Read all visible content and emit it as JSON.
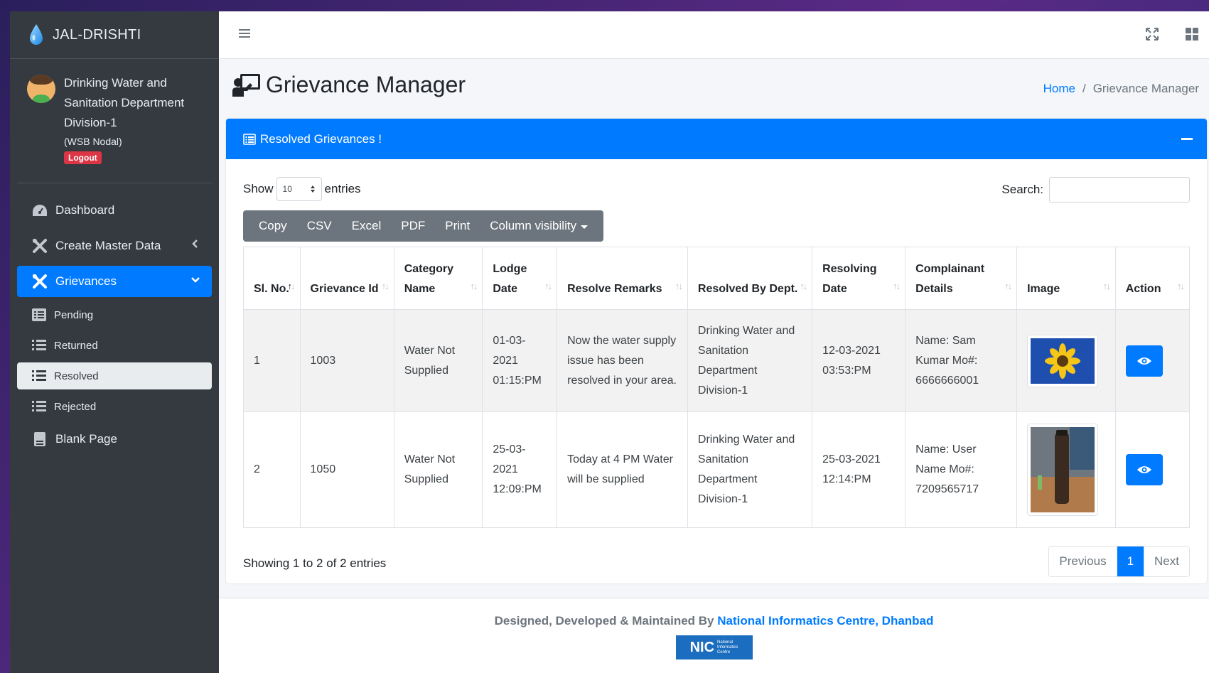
{
  "brand": {
    "name": "JAL-DRISHTI"
  },
  "user": {
    "name": "Drinking Water and Sanitation Department Division-1",
    "role": "(WSB Nodal)",
    "logout_label": "Logout"
  },
  "nav": {
    "dashboard": "Dashboard",
    "create_master": "Create Master Data",
    "grievances": "Grievances",
    "pending": "Pending",
    "returned": "Returned",
    "resolved": "Resolved",
    "rejected": "Rejected",
    "blank_page": "Blank Page"
  },
  "page": {
    "title": "Grievance Manager",
    "breadcrumb_home": "Home",
    "breadcrumb_sep": "/",
    "breadcrumb_current": "Grievance Manager"
  },
  "card": {
    "title": "Resolved Grievances !"
  },
  "controls": {
    "show": "Show",
    "entries_value": "10",
    "entries": "entries",
    "search_label": "Search:",
    "search_placeholder": ""
  },
  "buttons": {
    "copy": "Copy",
    "csv": "CSV",
    "excel": "Excel",
    "pdf": "PDF",
    "print": "Print",
    "colvis": "Column visibility"
  },
  "table": {
    "headers": [
      "Sl. No.",
      "Grievance Id",
      "Category Name",
      "Lodge Date",
      "Resolve Remarks",
      "Resolved By Dept.",
      "Resolving Date",
      "Complainant Details",
      "Image",
      "Action"
    ],
    "rows": [
      {
        "sl": "1",
        "id": "1003",
        "category": "Water Not Supplied",
        "lodge_date": "01-03-2021 01:15:PM",
        "remarks": "Now the water supply issue has been resolved in your area.",
        "dept": "Drinking Water and Sanitation Department Division-1",
        "resolving_date": "12-03-2021 03:53:PM",
        "complainant": "Name: Sam Kumar Mo#: 6666666001"
      },
      {
        "sl": "2",
        "id": "1050",
        "category": "Water Not Supplied",
        "lodge_date": "25-03-2021 12:09:PM",
        "remarks": "Today at 4 PM Water will be supplied",
        "dept": "Drinking Water and Sanitation Department Division-1",
        "resolving_date": "25-03-2021 12:14:PM",
        "complainant": "Name: User Name Mo#: 7209565717"
      }
    ]
  },
  "pagination": {
    "info": "Showing 1 to 2 of 2 entries",
    "previous": "Previous",
    "current": "1",
    "next": "Next"
  },
  "footer": {
    "text": "Designed, Developed & Maintained By",
    "org": "National Informatics Centre, Dhanbad",
    "logo_text": "NIC"
  },
  "colors": {
    "primary": "#007bff",
    "sidebar": "#343a40",
    "danger": "#dc3545",
    "secondary": "#6c757d"
  }
}
